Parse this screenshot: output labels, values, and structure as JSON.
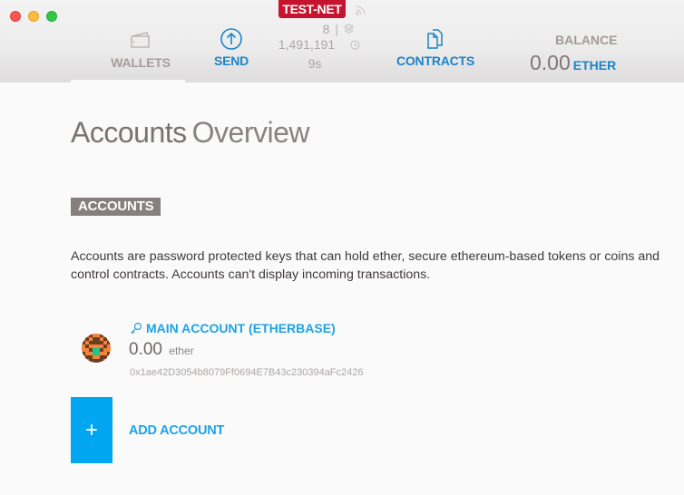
{
  "window": {
    "controls": [
      "close",
      "minimize",
      "maximize"
    ]
  },
  "header": {
    "network_badge": "TEST-NET",
    "peers": "8",
    "peers_separator": "|",
    "block_number": "1,491,191",
    "last_block_time": "9s",
    "nav": [
      {
        "label": "WALLETS",
        "icon": "wallet-icon",
        "active": true
      },
      {
        "label": "SEND",
        "icon": "send-icon",
        "active": false
      },
      {
        "label": "CONTRACTS",
        "icon": "contracts-icon",
        "active": false
      }
    ],
    "balance": {
      "label": "BALANCE",
      "value": "0.00",
      "unit": "ETHER"
    }
  },
  "main": {
    "title_bold": "Accounts",
    "title_light": "Overview",
    "section_label": "ACCOUNTS",
    "description": "Accounts are password protected keys that can hold ether, secure ethereum-based tokens or coins and control contracts. Accounts can't display incoming transactions.",
    "accounts": [
      {
        "name": "MAIN ACCOUNT (ETHERBASE)",
        "balance": "0.00",
        "unit": "ether",
        "address": "0x1ae42D3054b8079Ff0694E7B43c230394aFc2426"
      }
    ],
    "add_account_icon": "+",
    "add_account_label": "ADD ACCOUNT"
  },
  "colors": {
    "accent_blue": "#1ca3e5",
    "nav_blue": "#1b84c8",
    "testnet_red": "#c7142e",
    "add_button": "#00a6ef",
    "section_badge": "#877f7d"
  }
}
